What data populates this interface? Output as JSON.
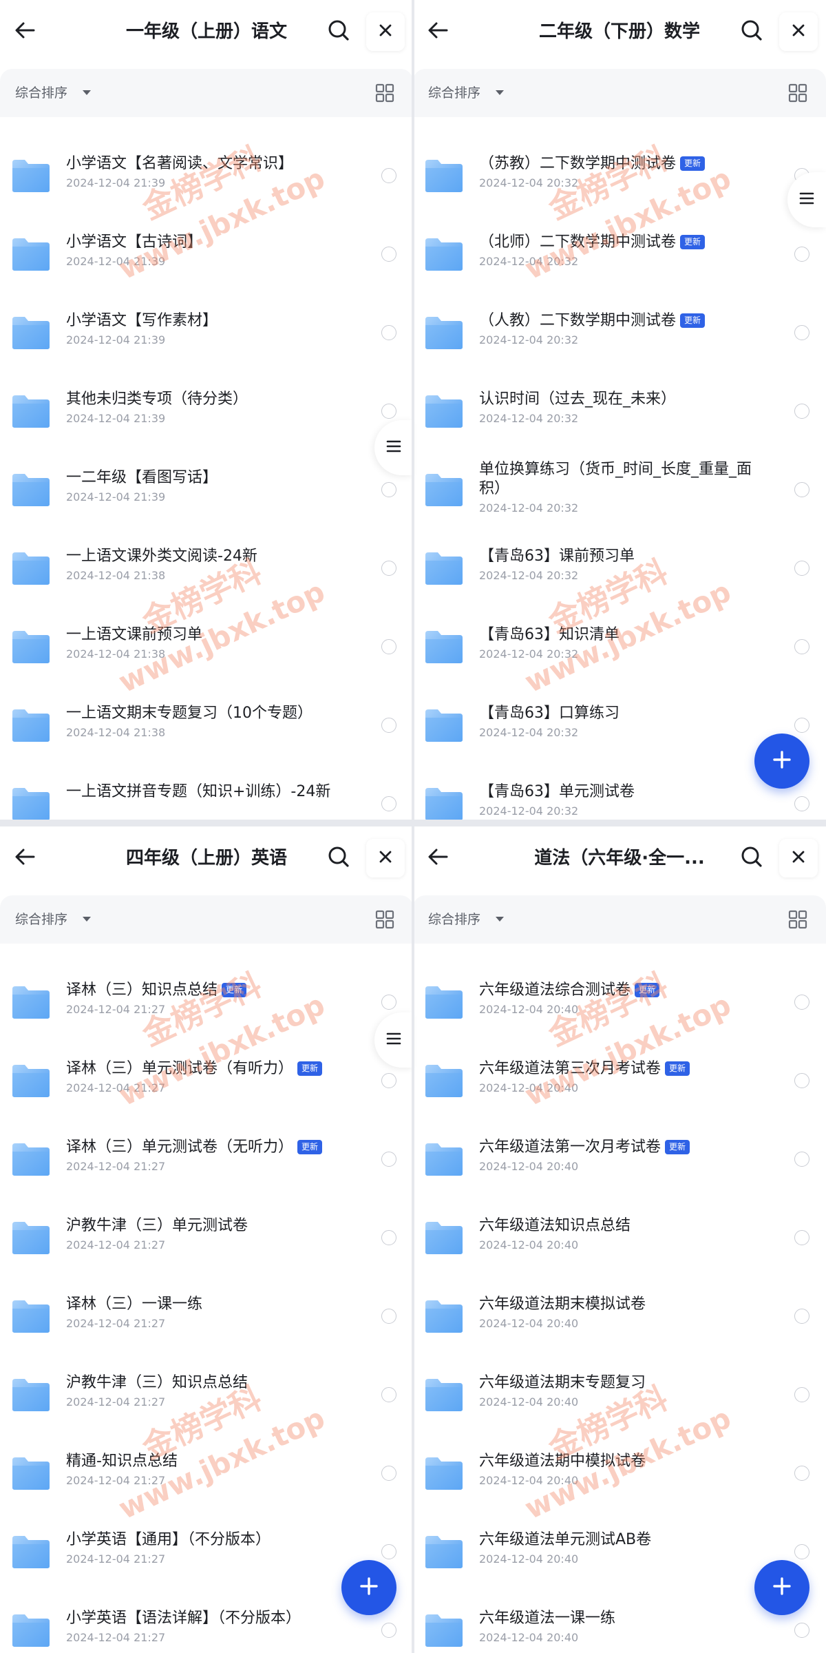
{
  "common": {
    "sort_label": "综合排序",
    "badge_label": "更新"
  },
  "watermark": {
    "cn": "金榜学科",
    "en": "www.jbxk.top"
  },
  "panels": [
    {
      "title": "一年级（上册）语文",
      "items": [
        {
          "name": "小学语文【名著阅读、文学常识】",
          "date": "2024-12-04 21:39",
          "badge": false
        },
        {
          "name": "小学语文【古诗词】",
          "date": "2024-12-04 21:39",
          "badge": false
        },
        {
          "name": "小学语文【写作素材】",
          "date": "2024-12-04 21:39",
          "badge": false
        },
        {
          "name": "其他未归类专项（待分类）",
          "date": "2024-12-04 21:39",
          "badge": false
        },
        {
          "name": "一二年级【看图写话】",
          "date": "2024-12-04 21:39",
          "badge": false
        },
        {
          "name": "一上语文课外类文阅读-24新",
          "date": "2024-12-04 21:38",
          "badge": false
        },
        {
          "name": "一上语文课前预习单",
          "date": "2024-12-04 21:38",
          "badge": false
        },
        {
          "name": "一上语文期末专题复习（10个专题）",
          "date": "2024-12-04 21:38",
          "badge": false
        },
        {
          "name": "一上语文拼音专题（知识+训练）-24新",
          "date": "",
          "badge": false
        }
      ]
    },
    {
      "title": "二年级（下册）数学",
      "items": [
        {
          "name": "（苏教）二下数学期中测试卷",
          "date": "2024-12-04 20:32",
          "badge": true
        },
        {
          "name": "（北师）二下数学期中测试卷",
          "date": "2024-12-04 20:32",
          "badge": true
        },
        {
          "name": "（人教）二下数学期中测试卷",
          "date": "2024-12-04 20:32",
          "badge": true
        },
        {
          "name": "认识时间（过去_现在_未来）",
          "date": "2024-12-04 20:32",
          "badge": false
        },
        {
          "name": "单位换算练习（货币_时间_长度_重量_面积）",
          "date": "2024-12-04 20:32",
          "badge": false
        },
        {
          "name": "【青岛63】课前预习单",
          "date": "2024-12-04 20:32",
          "badge": false
        },
        {
          "name": "【青岛63】知识清单",
          "date": "2024-12-04 20:32",
          "badge": false
        },
        {
          "name": "【青岛63】口算练习",
          "date": "2024-12-04 20:32",
          "badge": false
        },
        {
          "name": "【青岛63】单元测试卷",
          "date": "2024-12-04 20:32",
          "badge": false
        }
      ]
    },
    {
      "title": "四年级（上册）英语",
      "items": [
        {
          "name": "译林（三）知识点总结",
          "date": "2024-12-04 21:27",
          "badge": true
        },
        {
          "name": "译林（三）单元测试卷（有听力）",
          "date": "2024-12-04 21:27",
          "badge": true
        },
        {
          "name": "译林（三）单元测试卷（无听力）",
          "date": "2024-12-04 21:27",
          "badge": true
        },
        {
          "name": "沪教牛津（三）单元测试卷",
          "date": "2024-12-04 21:27",
          "badge": false
        },
        {
          "name": "译林（三）一课一练",
          "date": "2024-12-04 21:27",
          "badge": false
        },
        {
          "name": "沪教牛津（三）知识点总结",
          "date": "2024-12-04 21:27",
          "badge": false
        },
        {
          "name": "精通-知识点总结",
          "date": "2024-12-04 21:27",
          "badge": false
        },
        {
          "name": "小学英语【通用】（不分版本）",
          "date": "2024-12-04 21:27",
          "badge": false
        },
        {
          "name": "小学英语【语法详解】（不分版本）",
          "date": "2024-12-04 21:27",
          "badge": false
        }
      ]
    },
    {
      "title": "道法（六年级·全一...",
      "items": [
        {
          "name": "六年级道法综合测试卷",
          "date": "2024-12-04 20:40",
          "badge": true
        },
        {
          "name": "六年级道法第三次月考试卷",
          "date": "2024-12-04 20:40",
          "badge": true
        },
        {
          "name": "六年级道法第一次月考试卷",
          "date": "2024-12-04 20:40",
          "badge": true
        },
        {
          "name": "六年级道法知识点总结",
          "date": "2024-12-04 20:40",
          "badge": false
        },
        {
          "name": "六年级道法期末模拟试卷",
          "date": "2024-12-04 20:40",
          "badge": false
        },
        {
          "name": "六年级道法期末专题复习",
          "date": "2024-12-04 20:40",
          "badge": false
        },
        {
          "name": "六年级道法期中模拟试卷",
          "date": "2024-12-04 20:40",
          "badge": false
        },
        {
          "name": "六年级道法单元测试AB卷",
          "date": "2024-12-04 20:40",
          "badge": false
        },
        {
          "name": "六年级道法一课一练",
          "date": "2024-12-04 20:40",
          "badge": false
        }
      ]
    }
  ],
  "colors": {
    "accent": "#2356e6",
    "badge": "#2f62e6",
    "folder_light": "#a9d2fb",
    "folder_dark": "#4e9df2",
    "watermark": "#f28c6e"
  },
  "icons": [
    "back-arrow-icon",
    "search-icon",
    "close-icon",
    "grid-view-icon",
    "folder-icon",
    "menu-icon",
    "plus-icon"
  ]
}
